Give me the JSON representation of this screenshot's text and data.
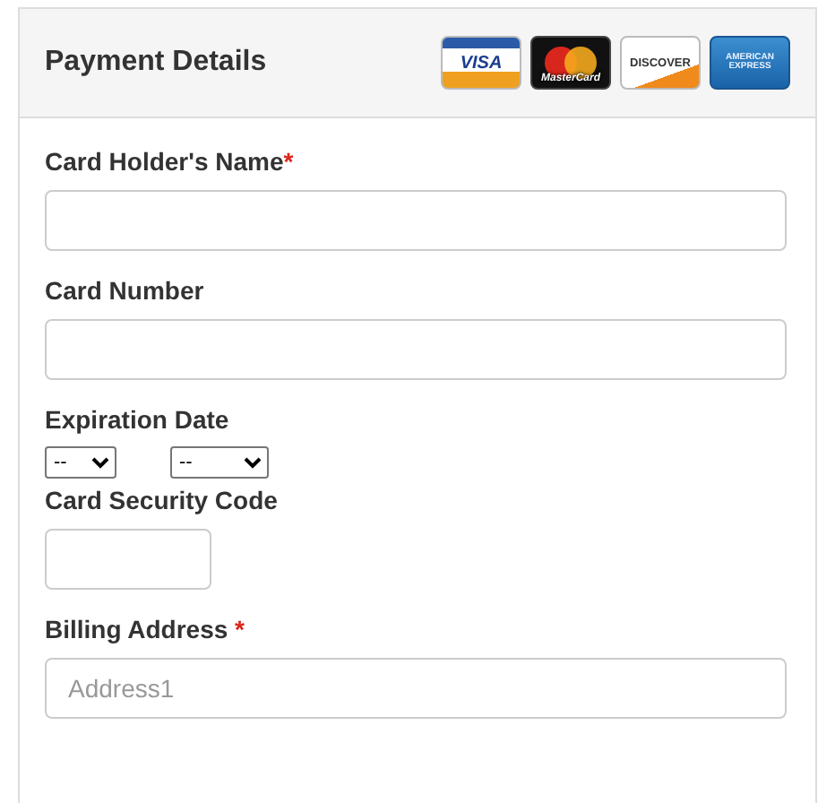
{
  "header": {
    "title": "Payment Details",
    "cards": [
      {
        "kind": "visa",
        "text": "VISA"
      },
      {
        "kind": "mastercard",
        "text": "MasterCard"
      },
      {
        "kind": "discover",
        "text": "DISCOVER"
      },
      {
        "kind": "amex",
        "text": "AMERICAN EXPRESS"
      }
    ]
  },
  "fields": [
    {
      "kind": "text",
      "label": "Card Holder's Name",
      "required_mark": "*"
    },
    {
      "kind": "text",
      "label": "Card Number"
    },
    {
      "kind": "expiry",
      "label": "Expiration Date",
      "month": "--",
      "year": "--"
    },
    {
      "kind": "short",
      "label": "Card Security Code"
    },
    {
      "kind": "text",
      "label": "Billing Address",
      "required_mark": " *",
      "placeholder": "Address1"
    }
  ]
}
